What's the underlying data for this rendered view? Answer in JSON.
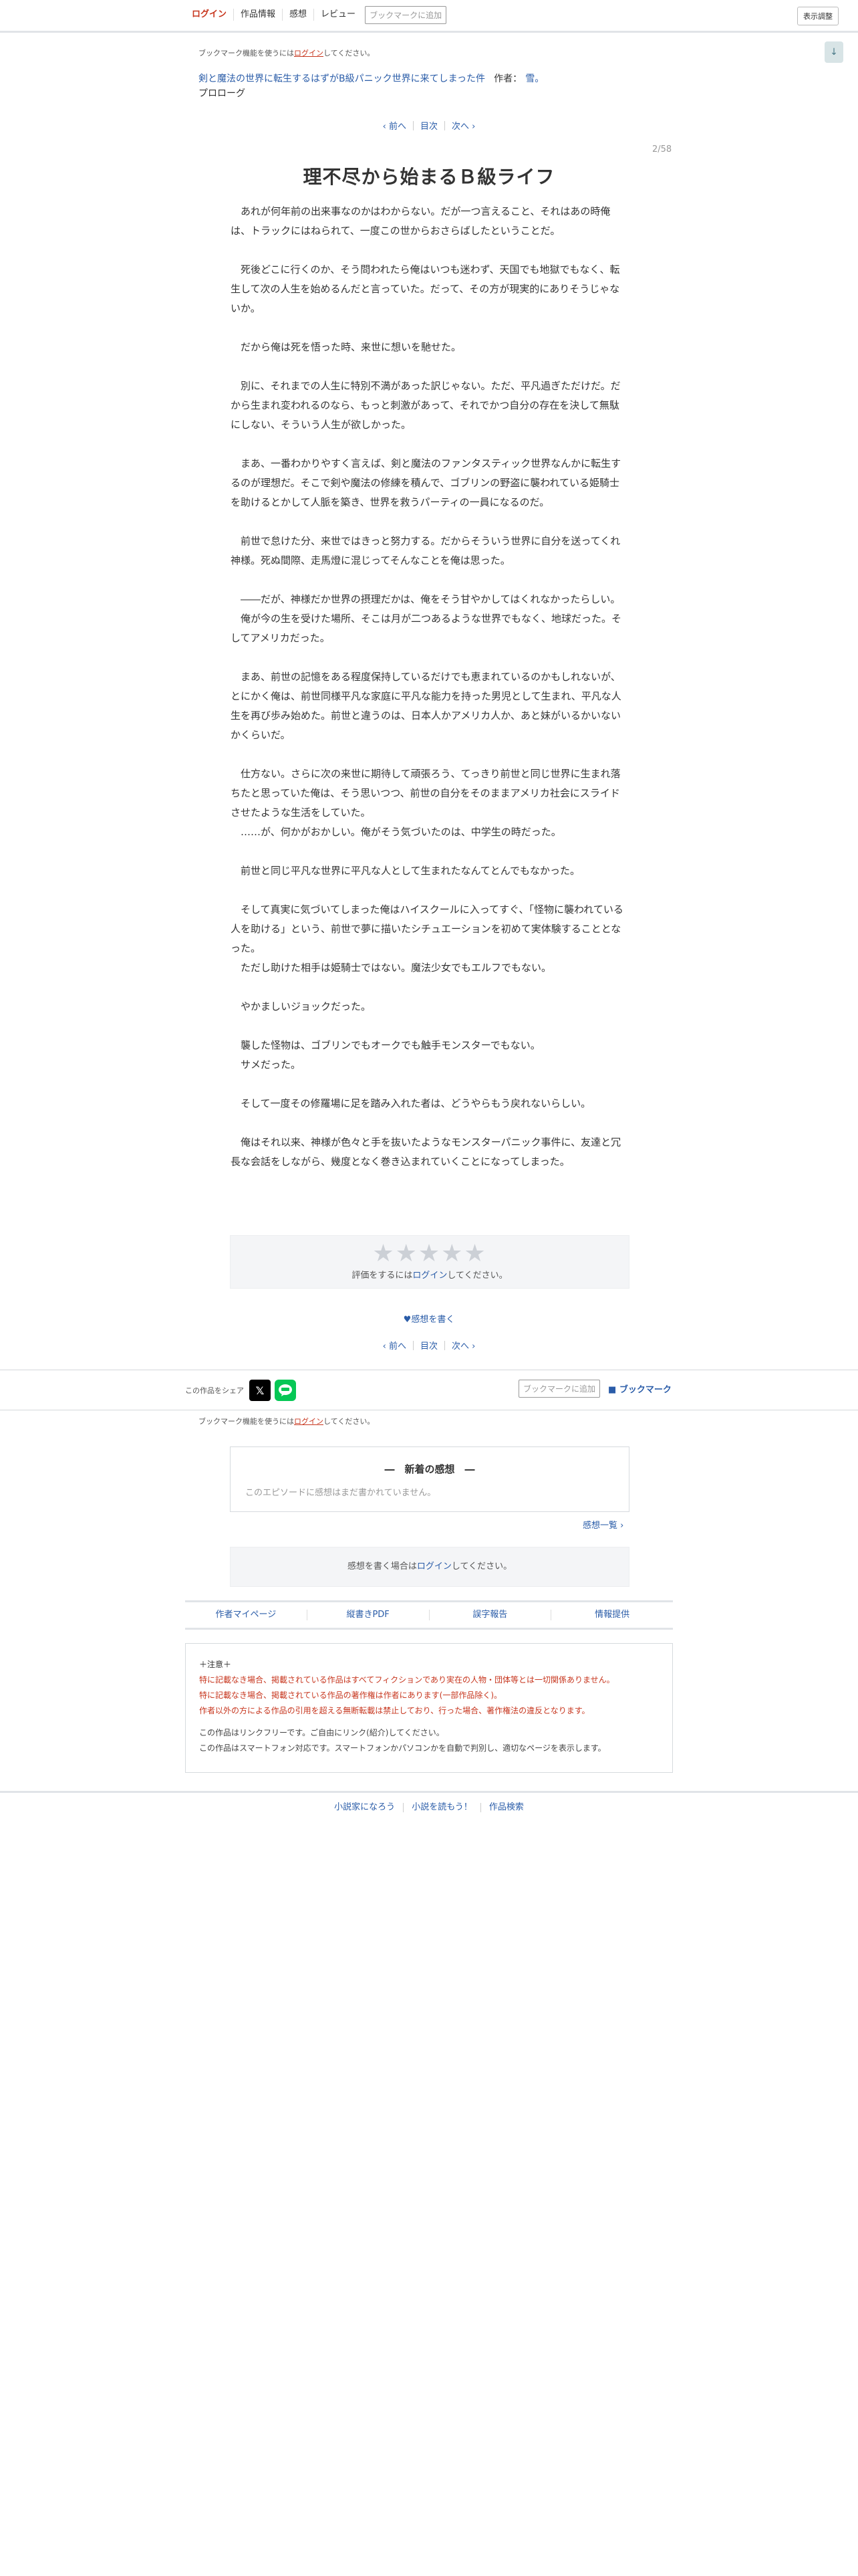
{
  "topbar": {
    "login": "ログイン",
    "work_info": "作品情報",
    "impressions": "感想",
    "review": "レビュー",
    "bookmark_add": "ブックマークに追加",
    "display_settings": "表示調整",
    "scroll_icon": "↓"
  },
  "bookmark_note": {
    "prefix": "ブックマーク機能を使うには",
    "link": "ログイン",
    "suffix": "してください。"
  },
  "work": {
    "series_title": "剣と魔法の世界に転生するはずがB級パニック世界に来てしまった件",
    "author_label": "作者：",
    "author_name": "雪。",
    "chapter": "プロローグ"
  },
  "pager": {
    "prev": "‹ 前へ",
    "toc": "目次",
    "next": "次へ ›"
  },
  "page_number": "2/58",
  "episode_title": "理不尽から始まるＢ級ライフ",
  "body": [
    "　あれが何年前の出来事なのかはわからない。だが一つ言えること、それはあの時俺は、トラックにはねられて、一度この世からおさらばしたということだ。",
    "",
    "　死後どこに行くのか、そう問われたら俺はいつも迷わず、天国でも地獄でもなく、転生して次の人生を始めるんだと言っていた。だって、その方が現実的にありそうじゃないか。",
    "",
    "　だから俺は死を悟った時、来世に想いを馳せた。",
    "",
    "　別に、それまでの人生に特別不満があった訳じゃない。ただ、平凡過ぎただけだ。だから生まれ変われるのなら、もっと刺激があって、それでかつ自分の存在を決して無駄にしない、そういう人生が欲しかった。",
    "",
    "　まあ、一番わかりやすく言えば、剣と魔法のファンタスティック世界なんかに転生するのが理想だ。そこで剣や魔法の修練を積んで、ゴブリンの野盗に襲われている姫騎士を助けるとかして人脈を築き、世界を救うパーティの一員になるのだ。",
    "",
    "　前世で怠けた分、来世ではきっと努力する。だからそういう世界に自分を送ってくれ神様。死ぬ間際、走馬燈に混じってそんなことを俺は思った。",
    "",
    "　――だが、神様だか世界の摂理だかは、俺をそう甘やかしてはくれなかったらしい。",
    "　俺が今の生を受けた場所、そこは月が二つあるような世界でもなく、地球だった。そしてアメリカだった。",
    "",
    "　まあ、前世の記憶をある程度保持しているだけでも恵まれているのかもしれないが、とにかく俺は、前世同様平凡な家庭に平凡な能力を持った男児として生まれ、平凡な人生を再び歩み始めた。前世と違うのは、日本人かアメリカ人か、あと妹がいるかいないかくらいだ。",
    "",
    "　仕方ない。さらに次の来世に期待して頑張ろう、てっきり前世と同じ世界に生まれ落ちたと思っていた俺は、そう思いつつ、前世の自分をそのままアメリカ社会にスライドさせたような生活をしていた。",
    "　……が、何かがおかしい。俺がそう気づいたのは、中学生の時だった。",
    "",
    "　前世と同じ平凡な世界に平凡な人として生まれたなんてとんでもなかった。",
    "",
    "　そして真実に気づいてしまった俺はハイスクールに入ってすぐ、「怪物に襲われている人を助ける」という、前世で夢に描いたシチュエーションを初めて実体験することとなった。",
    "　ただし助けた相手は姫騎士ではない。魔法少女でもエルフでもない。",
    "",
    "　やかましいジョックだった。",
    "",
    "　襲した怪物は、ゴブリンでもオークでも触手モンスターでもない。",
    "　サメだった。",
    "",
    "　そして一度その修羅場に足を踏み入れた者は、どうやらもう戻れないらしい。",
    "",
    "　俺はそれ以来、神様が色々と手を抜いたようなモンスターパニック事件に、友達と冗長な会話をしながら、幾度となく巻き込まれていくことになってしまった。"
  ],
  "rating": {
    "stars": "★★★★★",
    "prefix": "評価をするには",
    "link": "ログイン",
    "suffix": "してください。"
  },
  "write_impression_link": "♥感想を書く",
  "share": {
    "label": "この作品をシェア",
    "x_icon": "𝕏",
    "bookmark_add": "ブックマークに追加",
    "bookmark": "■ ブックマーク"
  },
  "impressions_section": {
    "heading": "―　新着の感想　―",
    "empty": "このエピソードに感想はまだ書かれていません。",
    "list_link": "感想一覧 ›",
    "write_prefix": "感想を書く場合は",
    "write_link": "ログイン",
    "write_suffix": "してください。"
  },
  "links": [
    "作者マイページ",
    "縦書きPDF",
    "誤字報告",
    "情報提供"
  ],
  "caution": {
    "heading": "＋注意＋",
    "red_lines": [
      "特に記載なき場合、掲載されている作品はすべてフィクションであり実在の人物・団体等とは一切関係ありません。",
      "特に記載なき場合、掲載されている作品の著作権は作者にあります(一部作品除く)。",
      "作者以外の方による作品の引用を超える無断転載は禁止しており、行った場合、著作権法の違反となります。"
    ],
    "normal_lines": [
      "この作品はリンクフリーです。ご自由にリンク(紹介)してください。",
      "この作品はスマートフォン対応です。スマートフォンかパソコンかを自動で判別し、適切なページを表示します。"
    ]
  },
  "footer": [
    "小説家になろう",
    "小説を読もう！",
    "作品検索"
  ],
  "colors": {
    "accent": "#2a5ca8",
    "login_red": "#c7361e",
    "line_green": "#06c755"
  }
}
